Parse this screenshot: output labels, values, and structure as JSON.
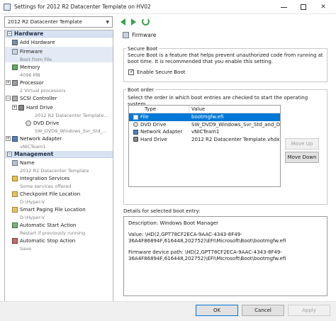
{
  "window": {
    "title": "Settings for 2012 R2 Datacenter Template on HV02"
  },
  "toolbar": {
    "vm_selected": "2012 R2 Datacenter Template"
  },
  "tree": {
    "hardware_label": "Hardware",
    "management_label": "Management",
    "hardware": [
      {
        "label": "Add Hardware",
        "sub": ""
      },
      {
        "label": "Firmware",
        "sub": "Boot from File"
      },
      {
        "label": "Memory",
        "sub": "4096 MB"
      },
      {
        "label": "Processor",
        "sub": "2 Virtual processors"
      },
      {
        "label": "SCSI Controller",
        "sub": ""
      },
      {
        "label": "Hard Drive",
        "sub": "2012 R2 Datacenter Template..."
      },
      {
        "label": "DVD Drive",
        "sub": "SW_DVD9_Windows_Svr_Std_..."
      },
      {
        "label": "Network Adapter",
        "sub": "vNICTeam1"
      }
    ],
    "management": [
      {
        "label": "Name",
        "sub": "2012 R2 Datacenter Template"
      },
      {
        "label": "Integration Services",
        "sub": "Some services offered"
      },
      {
        "label": "Checkpoint File Location",
        "sub": "D:\\Hyper-V"
      },
      {
        "label": "Smart Paging File Location",
        "sub": "D:\\Hyper-V"
      },
      {
        "label": "Automatic Start Action",
        "sub": "Restart if previously running"
      },
      {
        "label": "Automatic Stop Action",
        "sub": "Save"
      }
    ]
  },
  "firmware": {
    "header": "Firmware",
    "secure_boot": {
      "label": "Secure Boot",
      "description": "Secure Boot is a feature that helps prevent unauthorized code from running at boot time. It is recommended that you enable this setting.",
      "checkbox_label": "Enable Secure Boot",
      "checked": true
    },
    "boot_order": {
      "label": "Boot order",
      "description": "Select the order in which boot entries are checked to start the operating system.",
      "columns": [
        "Type",
        "Value"
      ],
      "rows": [
        {
          "type": "File",
          "value": "bootmgfw.efi"
        },
        {
          "type": "DVD Drive",
          "value": "SW_DVD9_Windows_Svr_Std_and_D..."
        },
        {
          "type": "Network Adapter",
          "value": "vNICTeam1"
        },
        {
          "type": "Hard Drive",
          "value": "2012 R2 Datacenter Template.vhdx"
        }
      ],
      "move_up": "Move Up",
      "move_down": "Move Down"
    },
    "details": {
      "label": "Details for selected boot entry:",
      "description": "Description: Windows Boot Manager",
      "value": "Value: \\HD(2,GPT78CF2ECA-9AAC-4343-8F49-36A4F86894F,616448,202752)\\EFI\\Microsoft\\Boot\\bootmgfw.efi",
      "device_path": "Firmware device path: \\HD(2,GPT78CF2ECA-9AAC-4343-8F49-36A4F86894F,616448,202752)\\EFI\\Microsoft\\Boot\\bootmgfw.efi"
    }
  },
  "footer": {
    "ok": "OK",
    "cancel": "Cancel",
    "apply": "Apply"
  }
}
